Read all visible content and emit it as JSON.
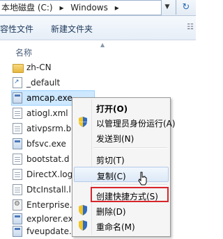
{
  "address": {
    "segments": [
      "本地磁盘 (C:)",
      "▸",
      "Windows",
      "▸"
    ],
    "dropdown_icon": "chevron-down-icon",
    "refresh_icon": "refresh-icon"
  },
  "toolbar": {
    "include_label": "容性文件",
    "new_folder_label": "新建文件夹",
    "view_icon": "view-options-icon"
  },
  "columns": {
    "name_label": "名称"
  },
  "files": [
    {
      "name": "zh-CN",
      "icon": "folder-icon"
    },
    {
      "name": "_default",
      "icon": "shortcut-file-icon"
    },
    {
      "name": "amcap.exe",
      "icon": "exe-icon",
      "selected": true
    },
    {
      "name": "atiogl.xml",
      "icon": "document-icon"
    },
    {
      "name": "ativpsrm.b",
      "icon": "document-icon"
    },
    {
      "name": "bfsvc.exe",
      "icon": "exe-icon"
    },
    {
      "name": "bootstat.d",
      "icon": "document-icon"
    },
    {
      "name": "DirectX.log",
      "icon": "document-icon"
    },
    {
      "name": "DtcInstall.l",
      "icon": "document-icon"
    },
    {
      "name": "Enterprise.",
      "icon": "config-file-icon"
    },
    {
      "name": "explorer.ex",
      "icon": "exe-icon"
    },
    {
      "name": "fveupdate.",
      "icon": "exe-icon"
    }
  ],
  "context_menu": {
    "open": "打开(O)",
    "run_as_admin": "以管理员身份运行(A)",
    "send_to": "发送到(N)",
    "cut": "剪切(T)",
    "copy": "复制(C)",
    "create_shortcut": "创建快捷方式(S)",
    "delete": "删除(D)",
    "rename": "重命名(M)"
  },
  "colors": {
    "highlight_box": "#d8252a",
    "selection": "#cde8ff",
    "shield_blue": "#2f6bc4",
    "shield_yellow": "#f3c623"
  }
}
